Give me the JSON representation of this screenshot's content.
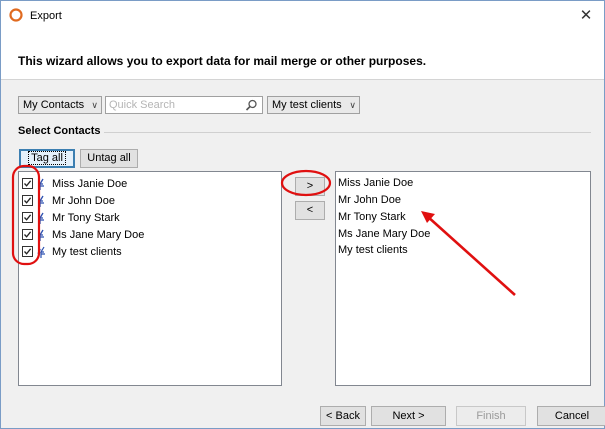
{
  "window": {
    "title": "Export",
    "close_glyph": "✕",
    "app_icon": "app-ring-icon"
  },
  "header": {
    "text": "This wizard allows you to export data for mail merge or other purposes."
  },
  "toolbar": {
    "contacts_combo": "My Contacts",
    "search_placeholder": "Quick Search",
    "search_value": "",
    "group_combo": "My test clients",
    "chevron": "∨"
  },
  "section": {
    "label": "Select Contacts"
  },
  "buttons": {
    "tag_all": "Tag all",
    "untag_all": "Untag all",
    "move_right": ">",
    "move_left": "<",
    "back": "< Back",
    "next": "Next >",
    "finish": "Finish",
    "cancel": "Cancel"
  },
  "left_list": [
    {
      "label": "Miss Janie Doe",
      "checked": true,
      "icon": "person-icon"
    },
    {
      "label": "Mr John Doe",
      "checked": true,
      "icon": "person-icon"
    },
    {
      "label": "Mr Tony Stark",
      "checked": true,
      "icon": "person-icon"
    },
    {
      "label": "Ms Jane Mary Doe",
      "checked": true,
      "icon": "person-icon"
    },
    {
      "label": "My test clients",
      "checked": true,
      "icon": "group-icon"
    }
  ],
  "right_list": [
    "Miss Janie Doe",
    "Mr John Doe",
    "Mr Tony Stark",
    "Ms Jane Mary Doe",
    "My test clients"
  ],
  "colors": {
    "annotation_red": "#e01010",
    "person_icon_blue": "#2a4fb0",
    "accent_blue": "#3c7fb1",
    "app_icon_orange": "#e06a1f"
  }
}
